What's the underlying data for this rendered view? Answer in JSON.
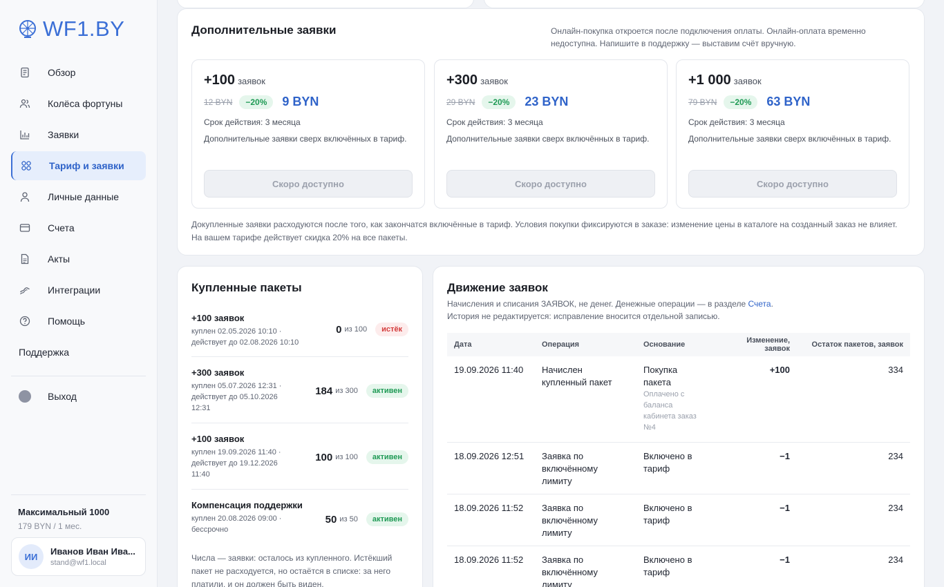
{
  "brand": {
    "name": "WF1.BY"
  },
  "nav": {
    "items": [
      {
        "label": "Обзор",
        "icon": "document-icon"
      },
      {
        "label": "Колёса фортуны",
        "icon": "users-icon"
      },
      {
        "label": "Заявки",
        "icon": "bar-chart-icon"
      },
      {
        "label": "Тариф и заявки",
        "icon": "grid-icon"
      },
      {
        "label": "Личные данные",
        "icon": "user-icon"
      },
      {
        "label": "Счета",
        "icon": "card-icon"
      },
      {
        "label": "Акты",
        "icon": "file-icon"
      },
      {
        "label": "Интеграции",
        "icon": "link-icon"
      },
      {
        "label": "Помощь",
        "icon": "help-icon"
      }
    ],
    "support": "Поддержка",
    "exit": "Выход"
  },
  "plan": {
    "name": "Максимальный 1000",
    "price": "179 BYN / 1 мес."
  },
  "user": {
    "initials": "ИИ",
    "name": "Иванов Иван Ива...",
    "email": "stand@wf1.local"
  },
  "extra": {
    "title": "Дополнительные заявки",
    "notice": "Онлайн-покупка откроется после подключения оплаты. Онлайн-оплата временно недоступна. Напишите в поддержку — выставим счёт вручную.",
    "packages": [
      {
        "count": "+100",
        "unit": "заявок",
        "old_price": "12 BYN",
        "discount": "−20%",
        "new_price": "9 BYN",
        "validity": "Срок действия: 3 месяца",
        "desc": "Дополнительные заявки сверх включённых в тариф.",
        "button": "Скоро доступно"
      },
      {
        "count": "+300",
        "unit": "заявок",
        "old_price": "29 BYN",
        "discount": "−20%",
        "new_price": "23 BYN",
        "validity": "Срок действия: 3 месяца",
        "desc": "Дополнительные заявки сверх включённых в тариф.",
        "button": "Скоро доступно"
      },
      {
        "count": "+1 000",
        "unit": "заявок",
        "old_price": "79 BYN",
        "discount": "−20%",
        "new_price": "63 BYN",
        "validity": "Срок действия: 3 месяца",
        "desc": "Дополнительные заявки сверх включённых в тариф.",
        "button": "Скоро доступно"
      }
    ],
    "footer": "Докупленные заявки расходуются после того, как закончатся включённые в тариф. Условия покупки фиксируются в заказе: изменение цены в каталоге на созданный заказ не влияет. На вашем тарифе действует скидка 20% на все пакеты."
  },
  "bought": {
    "title": "Купленные пакеты",
    "items": [
      {
        "title": "+100 заявок",
        "sub": "куплен 02.05.2026 10:10 · действует до 02.08.2026 10:10",
        "remain": "0",
        "of": "из 100",
        "status": "истёк"
      },
      {
        "title": "+300 заявок",
        "sub": "куплен 05.07.2026 12:31 · действует до 05.10.2026 12:31",
        "remain": "184",
        "of": "из 300",
        "status": "активен"
      },
      {
        "title": "+100 заявок",
        "sub": "куплен 19.09.2026 11:40 · действует до 19.12.2026 11:40",
        "remain": "100",
        "of": "из 100",
        "status": "активен"
      },
      {
        "title": "Компенсация поддержки",
        "sub": "куплен 20.08.2026 09:00 · бессрочно",
        "remain": "50",
        "of": "из 50",
        "status": "активен"
      }
    ],
    "note": "Числа — заявки: осталось из купленного. Истёкший пакет не расходуется, но остаётся в списке: за него платили, и он должен быть виден."
  },
  "movement": {
    "title": "Движение заявок",
    "desc1_pre": "Начисления и списания ЗАЯВОК, не денег. Денежные операции — в разделе ",
    "desc1_link": "Счета",
    "desc1_post": ".",
    "desc2": "История не редактируется: исправление вносится отдельной записью.",
    "columns": [
      "Дата",
      "Операция",
      "Основание",
      "Изменение, заявок",
      "Остаток пакетов, заявок"
    ],
    "rows": [
      {
        "date": "19.09.2026 11:40",
        "op": "Начислен купленный пакет",
        "basis": "Покупка пакета",
        "basis_note": "Оплачено с баланса кабинета заказ №4",
        "change": "+100",
        "rest": "334"
      },
      {
        "date": "18.09.2026 12:51",
        "op": "Заявка по включённому лимиту",
        "basis": "Включено в тариф",
        "basis_note": "",
        "change": "−1",
        "rest": "234"
      },
      {
        "date": "18.09.2026 11:52",
        "op": "Заявка по включённому лимиту",
        "basis": "Включено в тариф",
        "basis_note": "",
        "change": "−1",
        "rest": "234"
      },
      {
        "date": "18.09.2026 11:52",
        "op": "Заявка по включённому лимиту",
        "basis": "Включено в тариф",
        "basis_note": "",
        "change": "−1",
        "rest": "234"
      }
    ]
  },
  "colors": {
    "accent": "#3b6fd6",
    "success": "#1f9a55",
    "danger": "#d43c3c",
    "background": "#f1f3f7"
  }
}
